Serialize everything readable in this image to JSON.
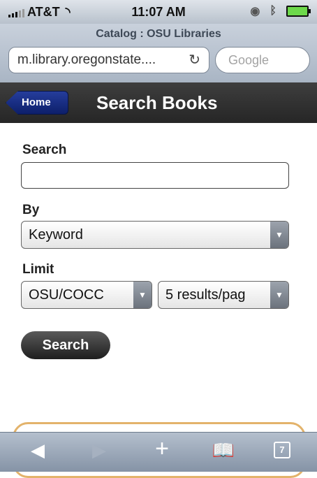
{
  "status": {
    "carrier": "AT&T",
    "time": "11:07 AM"
  },
  "browser": {
    "page_title": "Catalog : OSU Libraries",
    "url": "m.library.oregonstate....",
    "search_placeholder": "Google"
  },
  "nav": {
    "back_label": "Home",
    "title": "Search Books"
  },
  "form": {
    "search_label": "Search",
    "search_value": "",
    "by_label": "By",
    "by_selected": "Keyword",
    "limit_label": "Limit",
    "location_selected": "OSU/COCC",
    "results_selected": "5 results/pag",
    "submit_label": "Search"
  },
  "toolbar": {
    "tab_count": "7"
  },
  "icons": [
    "signal-icon",
    "wifi-icon",
    "alarm-icon",
    "bluetooth-icon",
    "battery-icon",
    "reload-icon",
    "back-arrow-icon",
    "forward-arrow-icon",
    "add-icon",
    "bookmarks-icon",
    "tabs-icon"
  ]
}
